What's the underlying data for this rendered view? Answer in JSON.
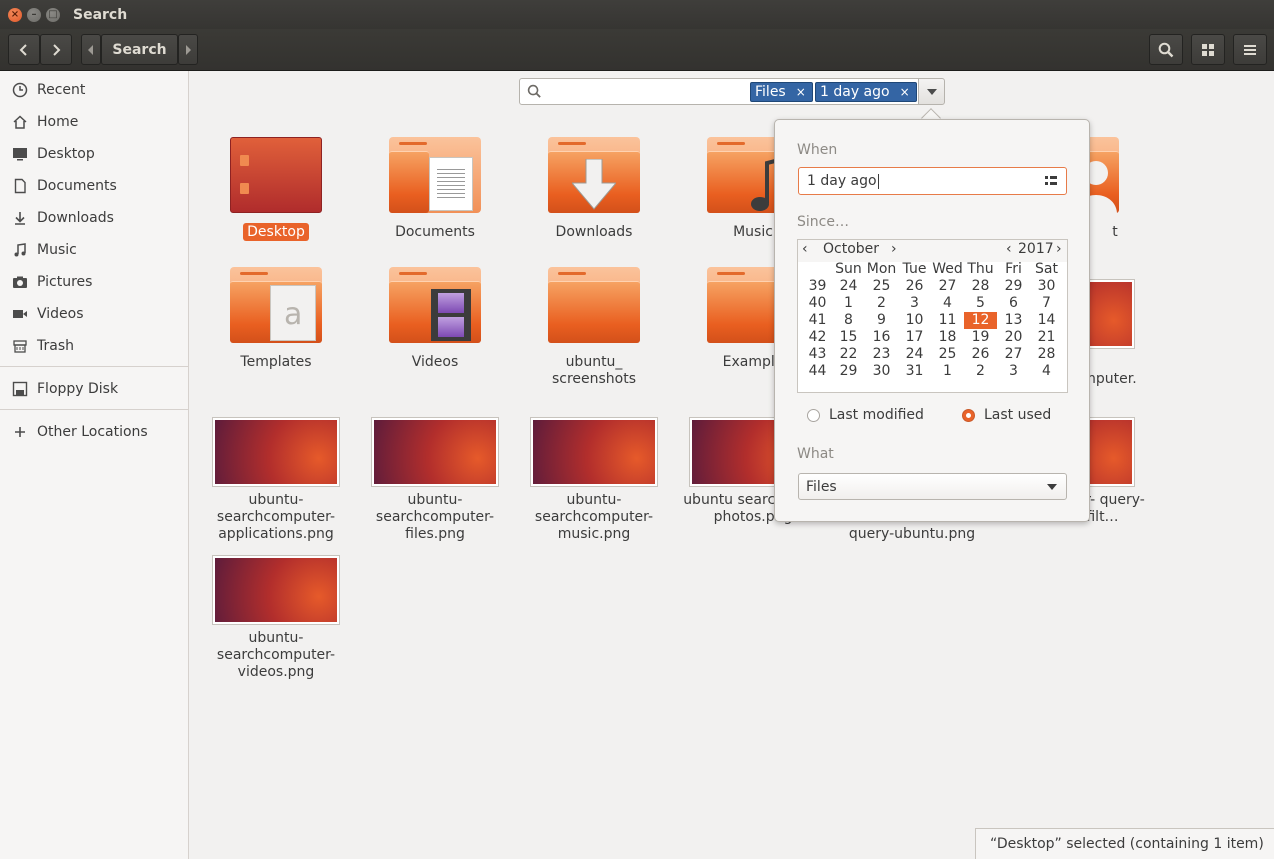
{
  "window": {
    "title": "Search"
  },
  "header": {
    "path_label": "Search"
  },
  "sidebar": {
    "items": [
      {
        "label": "Recent",
        "icon": "clock-icon"
      },
      {
        "label": "Home",
        "icon": "home-icon"
      },
      {
        "label": "Desktop",
        "icon": "desktop-icon"
      },
      {
        "label": "Documents",
        "icon": "document-icon"
      },
      {
        "label": "Downloads",
        "icon": "download-icon"
      },
      {
        "label": "Music",
        "icon": "music-icon"
      },
      {
        "label": "Pictures",
        "icon": "camera-icon"
      },
      {
        "label": "Videos",
        "icon": "video-icon"
      },
      {
        "label": "Trash",
        "icon": "trash-icon"
      },
      {
        "label": "Floppy Disk",
        "icon": "floppy-icon"
      },
      {
        "label": "Other Locations",
        "icon": "plus-icon"
      }
    ]
  },
  "search": {
    "value": "",
    "tags": [
      {
        "label": "Files"
      },
      {
        "label": "1 day ago"
      }
    ]
  },
  "files": [
    {
      "label": "Desktop",
      "kind": "folder-desktop",
      "selected": true
    },
    {
      "label": "Documents",
      "kind": "folder-documents"
    },
    {
      "label": "Downloads",
      "kind": "folder-downloads"
    },
    {
      "label": "Music",
      "kind": "folder-music"
    },
    {
      "label": "t",
      "kind": "folder-person"
    },
    {
      "label": "Templates",
      "kind": "folder-templates"
    },
    {
      "label": "Videos",
      "kind": "folder-videos"
    },
    {
      "label": "ubuntu_ screenshots",
      "kind": "folder"
    },
    {
      "label": "Example",
      "kind": "folder-examples"
    },
    {
      "label": "u- computer.",
      "kind": "image"
    },
    {
      "label": "ubuntu- searchcomputer- applications.png",
      "kind": "image"
    },
    {
      "label": "ubuntu- searchcomputer- files.png",
      "kind": "image"
    },
    {
      "label": "ubuntu- searchcomputer- music.png",
      "kind": "image"
    },
    {
      "label": "ubuntu searchcomp photos.png",
      "kind": "image"
    },
    {
      "label": "query-ubuntu.png",
      "kind": "image"
    },
    {
      "label": "u- computer- query-ubuntu-filt…",
      "kind": "image"
    },
    {
      "label": "ubuntu- searchcomputer- videos.png",
      "kind": "image"
    }
  ],
  "popover": {
    "when_label": "When",
    "when_value": "1 day ago",
    "since_label": "Since…",
    "calendar": {
      "month": "October",
      "year": "2017",
      "weekday_headers": [
        "Sun",
        "Mon",
        "Tue",
        "Wed",
        "Thu",
        "Fri",
        "Sat"
      ],
      "weeks": [
        {
          "num": "39",
          "days": [
            "24",
            "25",
            "26",
            "27",
            "28",
            "29",
            "30"
          ]
        },
        {
          "num": "40",
          "days": [
            "1",
            "2",
            "3",
            "4",
            "5",
            "6",
            "7"
          ]
        },
        {
          "num": "41",
          "days": [
            "8",
            "9",
            "10",
            "11",
            "12",
            "13",
            "14"
          ]
        },
        {
          "num": "42",
          "days": [
            "15",
            "16",
            "17",
            "18",
            "19",
            "20",
            "21"
          ]
        },
        {
          "num": "43",
          "days": [
            "22",
            "23",
            "24",
            "25",
            "26",
            "27",
            "28"
          ]
        },
        {
          "num": "44",
          "days": [
            "29",
            "30",
            "31",
            "1",
            "2",
            "3",
            "4"
          ]
        }
      ],
      "selected_day": "12"
    },
    "radio_last_modified": "Last modified",
    "radio_last_used": "Last used",
    "radio_selected": "Last used",
    "what_label": "What",
    "what_value": "Files"
  },
  "status": {
    "text": "“Desktop” selected  (containing 1 item)"
  },
  "colors": {
    "accent": "#e9632a",
    "tag_blue": "#3465a4",
    "header_dark": "#3b3a36"
  }
}
